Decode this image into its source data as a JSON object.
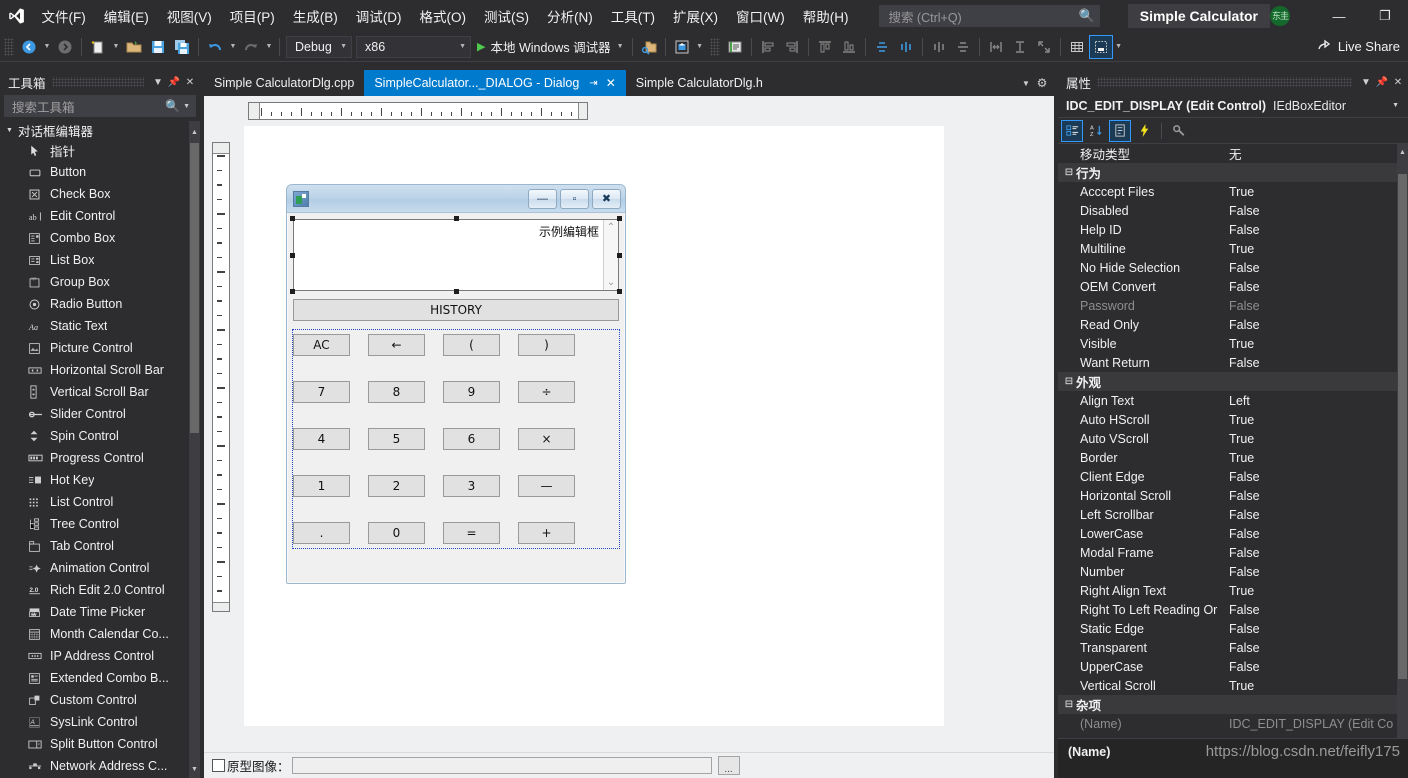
{
  "menu": {
    "logo_icon": "visual-studio-logo",
    "items": [
      {
        "label": "文件(F)"
      },
      {
        "label": "编辑(E)"
      },
      {
        "label": "视图(V)"
      },
      {
        "label": "项目(P)"
      },
      {
        "label": "生成(B)"
      },
      {
        "label": "调试(D)"
      },
      {
        "label": "格式(O)"
      },
      {
        "label": "测试(S)"
      },
      {
        "label": "分析(N)"
      },
      {
        "label": "工具(T)"
      },
      {
        "label": "扩展(X)"
      },
      {
        "label": "窗口(W)"
      },
      {
        "label": "帮助(H)"
      }
    ],
    "search_placeholder": "搜索 (Ctrl+Q)",
    "search_icon": "search-icon",
    "window_title": "Simple Calculator",
    "account_badge": "东圭",
    "minimize": "—",
    "restore": "❐"
  },
  "toolbar": {
    "config": "Debug",
    "platform": "x86",
    "run_label": "本地 Windows 调试器",
    "live_share": "Live Share",
    "caret": "▾"
  },
  "toolbox": {
    "title": "工具箱",
    "search_placeholder": "搜索工具箱",
    "category": "对话框编辑器",
    "items": [
      {
        "label": "指针",
        "icon": "pointer-icon"
      },
      {
        "label": "Button",
        "icon": "button-icon"
      },
      {
        "label": "Check Box",
        "icon": "checkbox-icon"
      },
      {
        "label": "Edit Control",
        "icon": "edit-control-icon"
      },
      {
        "label": "Combo Box",
        "icon": "combo-box-icon"
      },
      {
        "label": "List Box",
        "icon": "list-box-icon"
      },
      {
        "label": "Group Box",
        "icon": "group-box-icon"
      },
      {
        "label": "Radio Button",
        "icon": "radio-button-icon"
      },
      {
        "label": "Static Text",
        "icon": "static-text-icon"
      },
      {
        "label": "Picture Control",
        "icon": "picture-control-icon"
      },
      {
        "label": "Horizontal Scroll Bar",
        "icon": "hscroll-icon"
      },
      {
        "label": "Vertical Scroll Bar",
        "icon": "vscroll-icon"
      },
      {
        "label": "Slider Control",
        "icon": "slider-icon"
      },
      {
        "label": "Spin Control",
        "icon": "spin-icon"
      },
      {
        "label": "Progress Control",
        "icon": "progress-icon"
      },
      {
        "label": "Hot Key",
        "icon": "hotkey-icon"
      },
      {
        "label": "List Control",
        "icon": "list-control-icon"
      },
      {
        "label": "Tree Control",
        "icon": "tree-control-icon"
      },
      {
        "label": "Tab Control",
        "icon": "tab-control-icon"
      },
      {
        "label": "Animation Control",
        "icon": "animation-icon"
      },
      {
        "label": "Rich Edit 2.0 Control",
        "icon": "rich-edit-icon"
      },
      {
        "label": "Date Time Picker",
        "icon": "date-time-icon"
      },
      {
        "label": "Month Calendar Co...",
        "icon": "calendar-icon"
      },
      {
        "label": "IP Address Control",
        "icon": "ip-address-icon"
      },
      {
        "label": "Extended Combo B...",
        "icon": "ext-combo-icon"
      },
      {
        "label": "Custom Control",
        "icon": "custom-control-icon"
      },
      {
        "label": "SysLink Control",
        "icon": "syslink-icon"
      },
      {
        "label": "Split Button Control",
        "icon": "split-button-icon"
      },
      {
        "label": "Network Address C...",
        "icon": "network-address-icon"
      }
    ]
  },
  "tabs": [
    {
      "label": "Simple CalculatorDlg.cpp",
      "active": false
    },
    {
      "label": "SimpleCalculator..._DIALOG - Dialog",
      "active": true,
      "pin": "⇥",
      "close": "✕"
    },
    {
      "label": "Simple CalculatorDlg.h",
      "active": false
    }
  ],
  "dialog": {
    "icon": "app-icon",
    "caption_buttons": [
      {
        "name": "minimize",
        "glyph": "—"
      },
      {
        "name": "maximize",
        "glyph": "▫"
      },
      {
        "name": "close",
        "glyph": "✖"
      }
    ],
    "edit_display_text": "示例编辑框",
    "scroll_up": "⌃",
    "scroll_down": "⌄",
    "history_button": "HISTORY",
    "keypad": [
      [
        "AC",
        "←",
        "(",
        ")"
      ],
      [
        "7",
        "8",
        "9",
        "÷"
      ],
      [
        "4",
        "5",
        "6",
        "×"
      ],
      [
        "1",
        "2",
        "3",
        "—"
      ],
      [
        ".",
        "0",
        "=",
        "+"
      ]
    ]
  },
  "designer_status": {
    "checkbox_label": "原型图像：",
    "input_value": "",
    "browse_label": "..."
  },
  "properties": {
    "title": "属性",
    "selected_name": "IDC_EDIT_DISPLAY (Edit Control)",
    "selected_editor": "IEdBoxEditor",
    "tool_icons": [
      "categorized-icon",
      "alphabetical-icon",
      "properties-icon",
      "events-icon",
      "property-pages-icon"
    ],
    "rows": [
      {
        "type": "prop",
        "key": "移动类型",
        "value": "无"
      },
      {
        "type": "group",
        "key": "行为"
      },
      {
        "type": "prop",
        "key": "Acccept Files",
        "value": "True"
      },
      {
        "type": "prop",
        "key": "Disabled",
        "value": "False"
      },
      {
        "type": "prop",
        "key": "Help ID",
        "value": "False"
      },
      {
        "type": "prop",
        "key": "Multiline",
        "value": "True"
      },
      {
        "type": "prop",
        "key": "No Hide Selection",
        "value": "False"
      },
      {
        "type": "prop",
        "key": "OEM Convert",
        "value": "False"
      },
      {
        "type": "prop",
        "key": "Password",
        "value": "False",
        "dim": true
      },
      {
        "type": "prop",
        "key": "Read Only",
        "value": "False"
      },
      {
        "type": "prop",
        "key": "Visible",
        "value": "True"
      },
      {
        "type": "prop",
        "key": "Want Return",
        "value": "False"
      },
      {
        "type": "group",
        "key": "外观"
      },
      {
        "type": "prop",
        "key": "Align Text",
        "value": "Left"
      },
      {
        "type": "prop",
        "key": "Auto HScroll",
        "value": "True"
      },
      {
        "type": "prop",
        "key": "Auto VScroll",
        "value": "True"
      },
      {
        "type": "prop",
        "key": "Border",
        "value": "True"
      },
      {
        "type": "prop",
        "key": "Client Edge",
        "value": "False"
      },
      {
        "type": "prop",
        "key": "Horizontal Scroll",
        "value": "False"
      },
      {
        "type": "prop",
        "key": "Left Scrollbar",
        "value": "False"
      },
      {
        "type": "prop",
        "key": "LowerCase",
        "value": "False"
      },
      {
        "type": "prop",
        "key": "Modal Frame",
        "value": "False"
      },
      {
        "type": "prop",
        "key": "Number",
        "value": "False"
      },
      {
        "type": "prop",
        "key": "Right Align Text",
        "value": "True"
      },
      {
        "type": "prop",
        "key": "Right To Left Reading Or",
        "value": "False"
      },
      {
        "type": "prop",
        "key": "Static Edge",
        "value": "False"
      },
      {
        "type": "prop",
        "key": "Transparent",
        "value": "False"
      },
      {
        "type": "prop",
        "key": "UpperCase",
        "value": "False"
      },
      {
        "type": "prop",
        "key": "Vertical Scroll",
        "value": "True"
      },
      {
        "type": "group",
        "key": "杂项"
      },
      {
        "type": "prop",
        "key": "(Name)",
        "value": "IDC_EDIT_DISPLAY (Edit Co",
        "dim": true
      }
    ],
    "description_title": "(Name)"
  },
  "watermark": "https://blog.csdn.net/feifly175",
  "colors": {
    "accent": "#007acc",
    "chrome": "#2d2d30",
    "panel": "#252526",
    "dialog_face": "#f0f0f0"
  }
}
